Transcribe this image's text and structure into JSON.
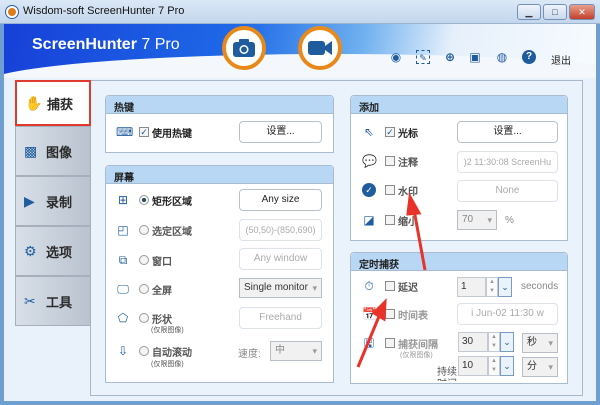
{
  "window": {
    "title": "Wisdom-soft ScreenHunter 7 Pro",
    "min": "▁",
    "max": "□",
    "close": "✕"
  },
  "banner": {
    "brand": "ScreenHunter",
    "version": "7 Pro",
    "exit": "退出"
  },
  "toolbar_icons": [
    "webcam-icon",
    "edit-icon",
    "zoom-icon",
    "film-icon",
    "user-icon",
    "help-icon"
  ],
  "tabs": [
    {
      "label": "捕获",
      "active": true
    },
    {
      "label": "图像"
    },
    {
      "label": "录制"
    },
    {
      "label": "选项"
    },
    {
      "label": "工具"
    }
  ],
  "hotkey": {
    "title": "热键",
    "use_hotkey": "使用热键",
    "checked": true,
    "settings": "设置..."
  },
  "screen": {
    "title": "屏幕",
    "options": [
      {
        "label": "矩形区域",
        "selected": true,
        "control": "Any size"
      },
      {
        "label": "选定区域",
        "control": "(50,50)-(850,690)"
      },
      {
        "label": "窗口",
        "control": "Any window"
      },
      {
        "label": "全屏",
        "control": "Single monitor"
      },
      {
        "label": "形状",
        "sub": "(仅限图像)",
        "control": "Freehand"
      },
      {
        "label": "自动滚动",
        "sub": "(仅限图像)",
        "speed_label": "速度:",
        "speed": "中"
      }
    ]
  },
  "add": {
    "title": "添加",
    "items": [
      {
        "label": "光标",
        "checked": true,
        "control": "设置..."
      },
      {
        "label": "注释",
        "checked": false,
        "control": ")2  11:30:08  ScreenHu"
      },
      {
        "label": "水印",
        "checked": false,
        "control": "None"
      },
      {
        "label": "缩小",
        "checked": false,
        "value": "70",
        "unit": "%"
      }
    ]
  },
  "timed": {
    "title": "定时捕获",
    "delay": {
      "label": "延迟",
      "value": "1",
      "unit": "seconds"
    },
    "schedule": {
      "label": "时间表",
      "value": "i Jun-02 11:30 w"
    },
    "interval": {
      "label": "捕获间隔",
      "sub": "(仅限图像)",
      "value": "30",
      "unit": "秒"
    },
    "duration": {
      "label": "持续",
      "label2": "时间",
      "value": "10",
      "unit": "分"
    }
  }
}
